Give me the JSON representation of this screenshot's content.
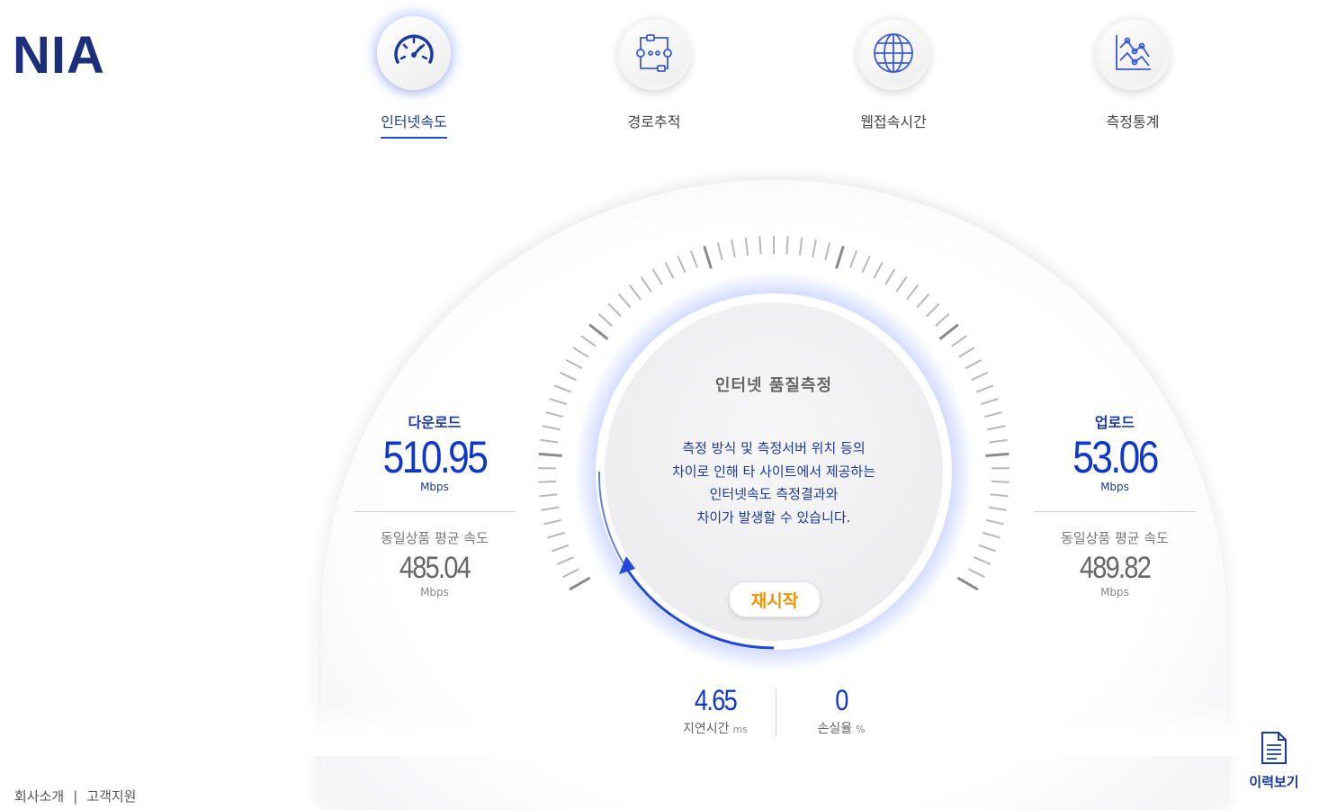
{
  "logo": "NIA",
  "nav": [
    {
      "label": "인터넷속도",
      "icon": "speedometer-icon",
      "active": true
    },
    {
      "label": "경로추적",
      "icon": "route-trace-icon",
      "active": false
    },
    {
      "label": "웹접속시간",
      "icon": "globe-icon",
      "active": false
    },
    {
      "label": "측정통계",
      "icon": "statistics-chart-icon",
      "active": false
    }
  ],
  "download": {
    "title": "다운로드",
    "value": "510.95",
    "unit": "Mbps",
    "avg_label": "동일상품 평균 속도",
    "avg_value": "485.04",
    "avg_unit": "Mbps"
  },
  "upload": {
    "title": "업로드",
    "value": "53.06",
    "unit": "Mbps",
    "avg_label": "동일상품 평균 속도",
    "avg_value": "489.82",
    "avg_unit": "Mbps"
  },
  "center": {
    "title": "인터넷 품질측정",
    "message": [
      "측정 방식 및 측정서버 위치 등의",
      "차이로 인해 타 사이트에서 제공하는",
      "인터넷속도 측정결과와",
      "차이가 발생할 수 있습니다."
    ],
    "restart_label": "재시작"
  },
  "latency": {
    "value": "4.65",
    "label": "지연시간",
    "unit": "ms"
  },
  "loss": {
    "value": "0",
    "label": "손실율",
    "unit": "%"
  },
  "history_label": "이력보기",
  "footer": {
    "about": "회사소개",
    "separator": "|",
    "support": "고객지원"
  },
  "colors": {
    "accent": "#1038c8",
    "restart": "#f39200",
    "navy": "#1b2f7a"
  }
}
